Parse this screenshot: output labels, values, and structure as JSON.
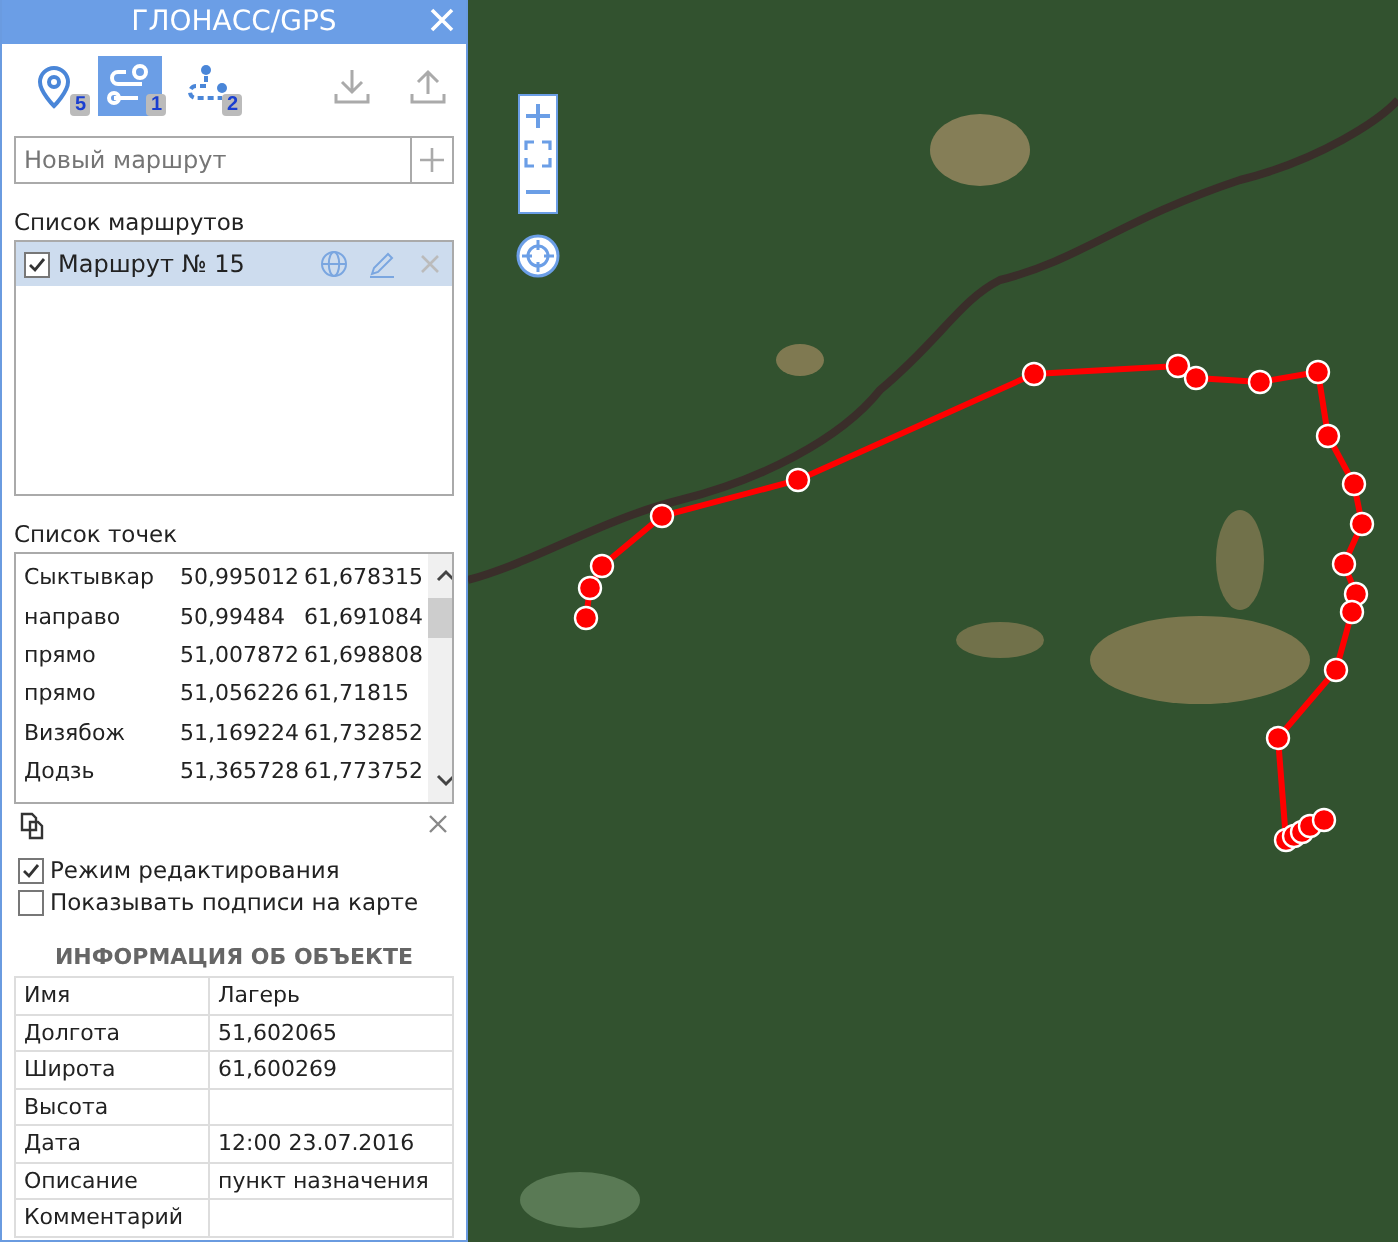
{
  "window": {
    "title": "ГЛОНАСС/GPS"
  },
  "tabs": [
    {
      "kind": "points",
      "badge": "5",
      "selected": false
    },
    {
      "kind": "routes",
      "badge": "1",
      "selected": true
    },
    {
      "kind": "tracks",
      "badge": "2",
      "selected": false
    }
  ],
  "new_route": {
    "placeholder": "Новый маршрут"
  },
  "routes_label": "Список маршрутов",
  "routes": [
    {
      "name": "Маршрут № 15",
      "checked": true,
      "selected": true
    }
  ],
  "points_label": "Список точек",
  "points": [
    {
      "name": "Сыктывкар",
      "lon": "50,995012",
      "lat": "61,678315"
    },
    {
      "name": "направо",
      "lon": "50,99484",
      "lat": "61,691084"
    },
    {
      "name": "прямо",
      "lon": "51,007872",
      "lat": "61,698808"
    },
    {
      "name": "прямо",
      "lon": "51,056226",
      "lat": "61,71815"
    },
    {
      "name": "Визябож",
      "lon": "51,169224",
      "lat": "61,732852"
    },
    {
      "name": "Додзь",
      "lon": "51,365728",
      "lat": "61,773752"
    }
  ],
  "options": [
    {
      "label": "Режим редактирования",
      "checked": true
    },
    {
      "label": "Показывать подписи на карте",
      "checked": false
    }
  ],
  "info": {
    "title": "ИНФОРМАЦИЯ ОБ ОБЪЕКТЕ",
    "rows": [
      {
        "label": "Имя",
        "value": "Лагерь"
      },
      {
        "label": "Долгота",
        "value": "51,602065"
      },
      {
        "label": "Широта",
        "value": "61,600269"
      },
      {
        "label": "Высота"
      },
      {
        "label": "Дата",
        "value": "12:00 23.07.2016"
      },
      {
        "label": "Описание",
        "value": "пункт назначения"
      },
      {
        "label": "Комментарий"
      }
    ]
  }
}
